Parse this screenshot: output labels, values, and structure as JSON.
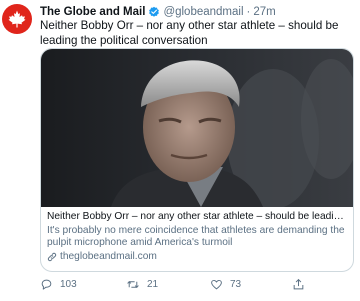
{
  "author": {
    "name": "The Globe and Mail",
    "handle": "@globeandmail",
    "separator": "·",
    "time": "27m",
    "avatar_icon": "maple-leaf-icon",
    "avatar_color": "#e0251b",
    "verified_color": "#1d9bf0"
  },
  "tweet": {
    "text": "Neither Bobby Orr – nor any other star athlete – should be leading the political conversation"
  },
  "card": {
    "title": "Neither Bobby Orr – nor any other star athlete – should be leading the ...",
    "description": "It's probably no mere coincidence that athletes are demanding the pulpit microphone amid America's turmoil",
    "domain": "theglobeandmail.com",
    "image_alt": "photo-older-man-grey-hair"
  },
  "actions": {
    "replies": "103",
    "retweets": "21",
    "likes": "73"
  },
  "colors": {
    "text": "#0f1419",
    "muted": "#5b7083",
    "border": "#cfd9de"
  }
}
